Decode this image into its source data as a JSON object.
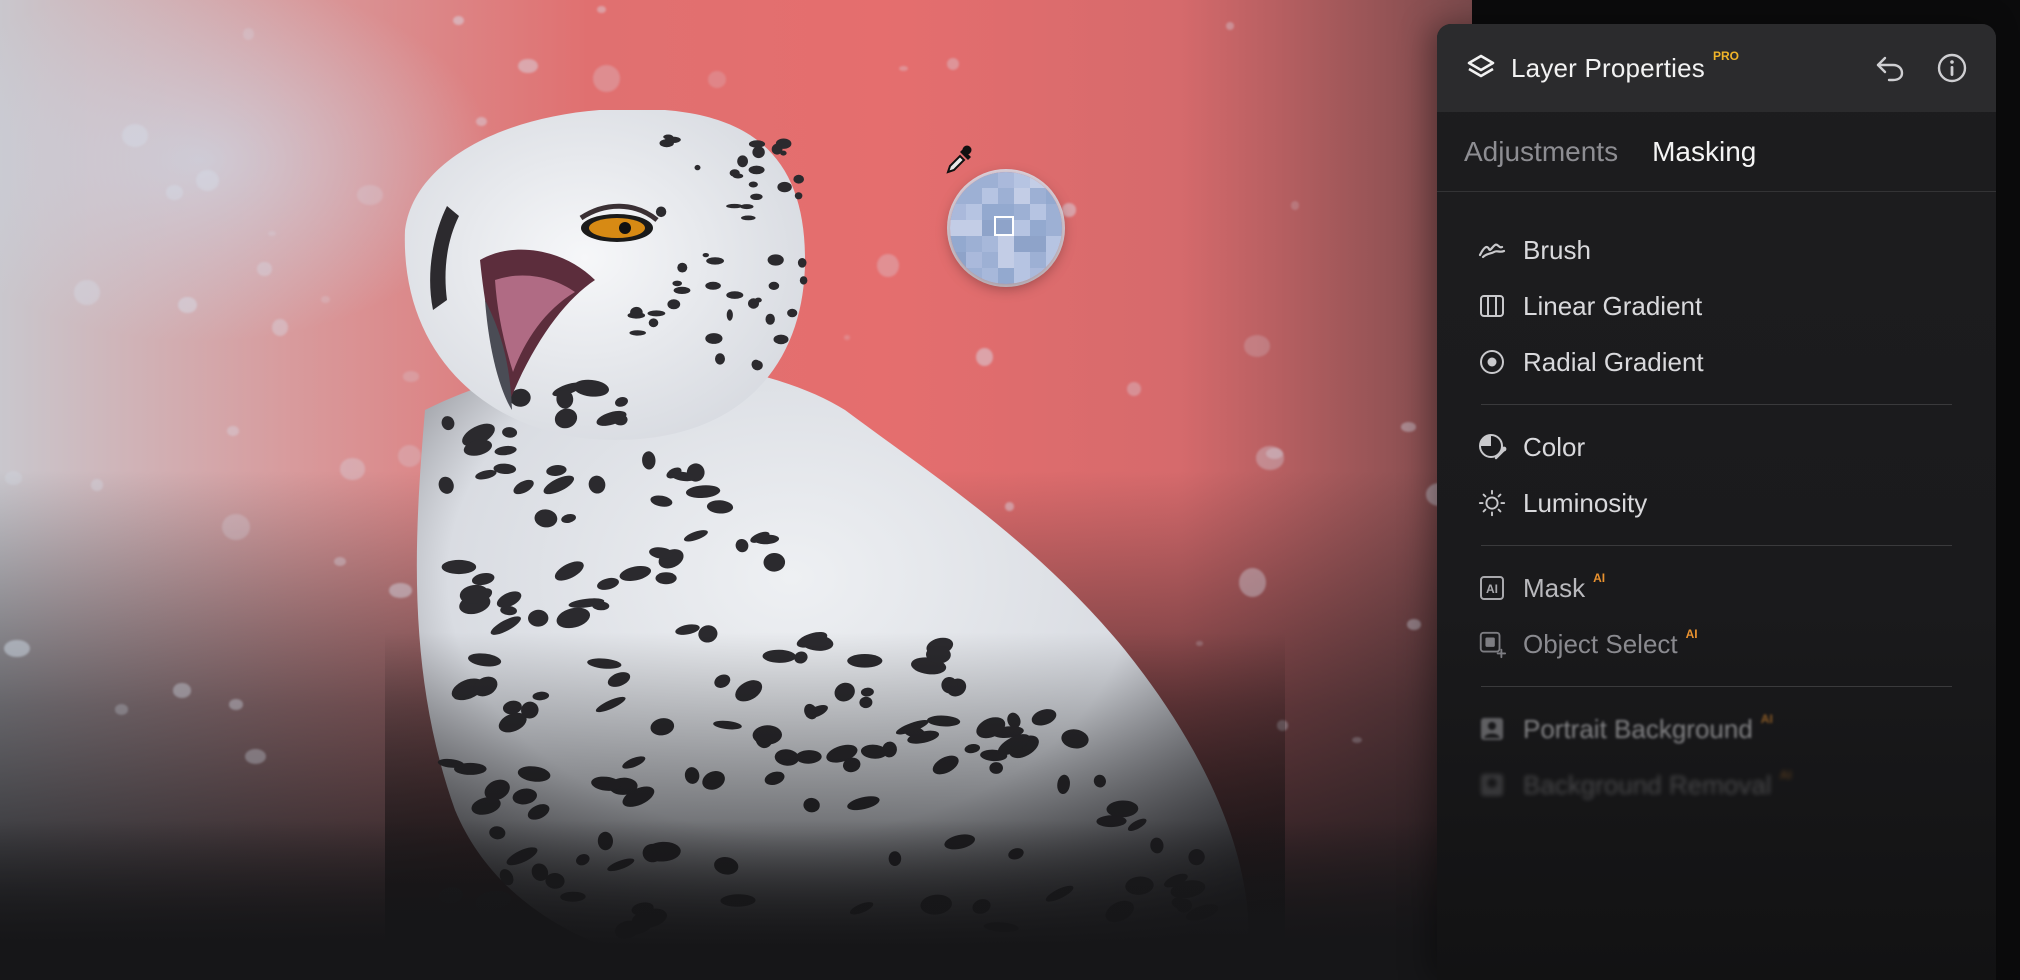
{
  "panel": {
    "title": "Layer Properties",
    "badge": "PRO",
    "undo_icon": "undo-icon",
    "info_icon": "info-icon",
    "tabs": [
      {
        "label": "Adjustments",
        "active": false
      },
      {
        "label": "Masking",
        "active": true
      }
    ],
    "groups": [
      [
        {
          "label": "Brush",
          "icon": "brush-icon"
        },
        {
          "label": "Linear Gradient",
          "icon": "linear-gradient-icon"
        },
        {
          "label": "Radial Gradient",
          "icon": "radial-gradient-icon"
        }
      ],
      [
        {
          "label": "Color",
          "icon": "color-icon"
        },
        {
          "label": "Luminosity",
          "icon": "luminosity-icon"
        }
      ],
      [
        {
          "label": "Mask",
          "icon": "ai-mask-icon",
          "tag": "AI"
        },
        {
          "label": "Object Select",
          "icon": "object-select-icon",
          "tag": "AI"
        }
      ],
      [
        {
          "label": "Portrait Background",
          "icon": "portrait-icon",
          "tag": "AI"
        },
        {
          "label": "Background Removal",
          "icon": "background-removal-icon",
          "tag": "AI"
        }
      ]
    ]
  },
  "colors": {
    "accent_pro": "#f0b429",
    "accent_ai": "#e8912f",
    "mask_overlay": "#e56e6e"
  }
}
